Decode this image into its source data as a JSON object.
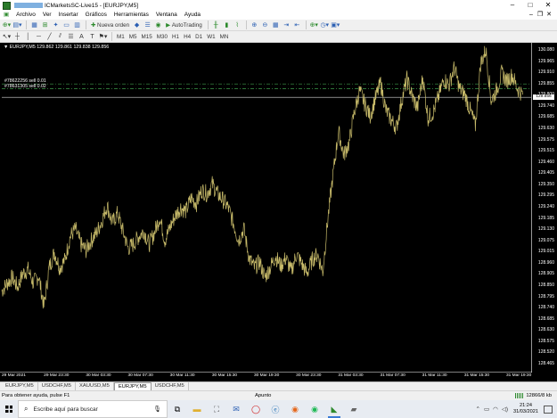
{
  "window": {
    "title": "ICMarketsSC-Live15 - [EURJPY,M5]",
    "controls": [
      "–",
      "□",
      "✕"
    ],
    "mdi_controls": [
      "–",
      "❐",
      "✕"
    ]
  },
  "menu": [
    "Archivo",
    "Ver",
    "Insertar",
    "Gráficos",
    "Herramientas",
    "Ventana",
    "Ayuda"
  ],
  "toolbar1": {
    "new_order": "Nueva orden",
    "autotrading": "AutoTrading"
  },
  "toolbar2": {
    "timeframes": [
      "M1",
      "M5",
      "M15",
      "M30",
      "H1",
      "H4",
      "D1",
      "W1",
      "MN"
    ],
    "text_tool": "A",
    "label_tool": "T"
  },
  "chart": {
    "symbol_info": "▼ EURJPY,M5  129.862  129.861  129.838  129.856",
    "orders": [
      {
        "label": "#78622256 sell 0.01",
        "price": 129.925
      },
      {
        "label": "#78631305 sell 0.02",
        "price": 129.9
      }
    ],
    "current_price": "129.856",
    "colors": {
      "background": "#000000",
      "line": "#c8bb6a",
      "order_line": "#3c9a4a"
    }
  },
  "chart_data": {
    "type": "line",
    "title": "",
    "price_ticks": [
      "130.080",
      "129.965",
      "129.910",
      "129.855",
      "129.800",
      "129.740",
      "129.685",
      "129.630",
      "129.575",
      "129.515",
      "129.460",
      "129.405",
      "129.350",
      "129.295",
      "129.240",
      "129.185",
      "129.130",
      "129.075",
      "129.015",
      "128.960",
      "128.905",
      "128.850",
      "128.795",
      "128.740",
      "128.685",
      "128.630",
      "128.575",
      "128.520",
      "128.465"
    ],
    "time_ticks": [
      "29 Mar 2021",
      "29 Mar 23:30",
      "30 Mar 03:30",
      "30 Mar 07:30",
      "30 Mar 11:30",
      "30 Mar 15:30",
      "30 Mar 19:30",
      "30 Mar 23:30",
      "31 Mar 03:30",
      "31 Mar 07:30",
      "31 Mar 11:30",
      "31 Mar 15:30",
      "31 Mar 19:30"
    ],
    "ylim": [
      128.45,
      130.1
    ],
    "x": [
      0,
      0.5,
      1,
      1.5,
      2,
      2.5,
      3,
      3.5,
      4,
      4.5,
      5,
      5.5,
      6,
      6.5,
      7,
      7.5,
      8,
      8.5,
      9,
      9.5,
      10,
      10.5,
      11,
      11.5,
      12,
      12.5,
      13,
      13.5,
      14,
      14.5,
      15,
      15.5,
      16,
      16.5,
      17,
      17.5,
      18,
      18.5,
      19,
      19.5,
      20,
      20.5,
      21,
      21.5,
      22,
      22.5,
      23,
      23.5,
      24,
      24.5,
      25,
      25.5,
      26,
      26.5,
      27,
      27.5,
      28,
      28.5,
      29,
      29.5,
      30,
      30.5,
      31,
      31.5,
      32,
      32.5,
      33,
      33.5,
      34,
      34.5,
      35,
      35.5,
      36,
      36.5,
      37,
      37.5,
      38,
      38.5,
      39,
      39.5,
      40,
      40.5,
      41,
      41.5,
      42,
      42.5,
      43,
      43.5,
      44,
      44.5,
      45,
      45.5,
      46,
      46.5,
      47,
      47.5,
      48,
      48.5,
      49,
      49.5
    ],
    "values": [
      128.86,
      128.9,
      128.93,
      128.88,
      128.95,
      128.97,
      128.9,
      128.94,
      128.78,
      128.98,
      129.06,
      128.98,
      129.02,
      129.14,
      129.18,
      129.1,
      129.07,
      129.12,
      129.16,
      129.22,
      129.3,
      129.21,
      129.26,
      129.17,
      129.08,
      129.1,
      129.14,
      129.17,
      129.1,
      129.16,
      129.24,
      129.12,
      129.19,
      129.25,
      129.29,
      129.27,
      129.34,
      129.31,
      129.38,
      129.36,
      129.41,
      129.36,
      129.33,
      129.29,
      129.21,
      129.12,
      129.18,
      129.03,
      128.98,
      129.01,
      128.93,
      128.98,
      129.04,
      128.99,
      129.03,
      128.96,
      129.05,
      129.0,
      128.95,
      129.02,
      129.05,
      128.96,
      129.24,
      129.47,
      129.68,
      129.56,
      129.62,
      129.78,
      129.89,
      129.82,
      129.76,
      129.85,
      129.93,
      129.79,
      129.74,
      129.7,
      129.84,
      129.95,
      129.86,
      129.8,
      129.96,
      129.75,
      129.78,
      129.86,
      129.95,
      129.92,
      130.01,
      129.9,
      129.87,
      129.79,
      129.71,
      130.03,
      130.1,
      129.84,
      129.89,
      129.98,
      129.94,
      129.97,
      129.9,
      129.87
    ]
  },
  "tabs": [
    "EURJPY,M5",
    "USDCHF,M5",
    "XAUUSD,M5",
    "EURJPY,M5",
    "USDCHF,M5"
  ],
  "active_tab": 3,
  "status": {
    "hint": "Para obtener ayuda, pulse F1",
    "profile": "Apunto",
    "traffic": "12866/8 kb"
  },
  "taskbar": {
    "search_placeholder": "Escribe aquí para buscar",
    "time": "21:24",
    "date": "31/03/2021"
  }
}
